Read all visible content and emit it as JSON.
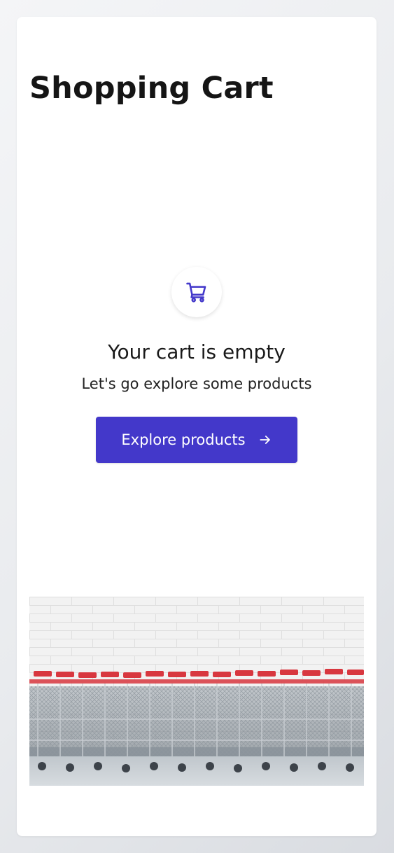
{
  "page": {
    "title": "Shopping Cart"
  },
  "empty_state": {
    "icon": "shopping-cart-icon",
    "heading": "Your cart is empty",
    "subtext": "Let's go explore some products",
    "button_label": "Explore products",
    "button_icon": "arrow-right-icon"
  },
  "colors": {
    "accent": "#4338ca",
    "background": "#ffffff"
  }
}
